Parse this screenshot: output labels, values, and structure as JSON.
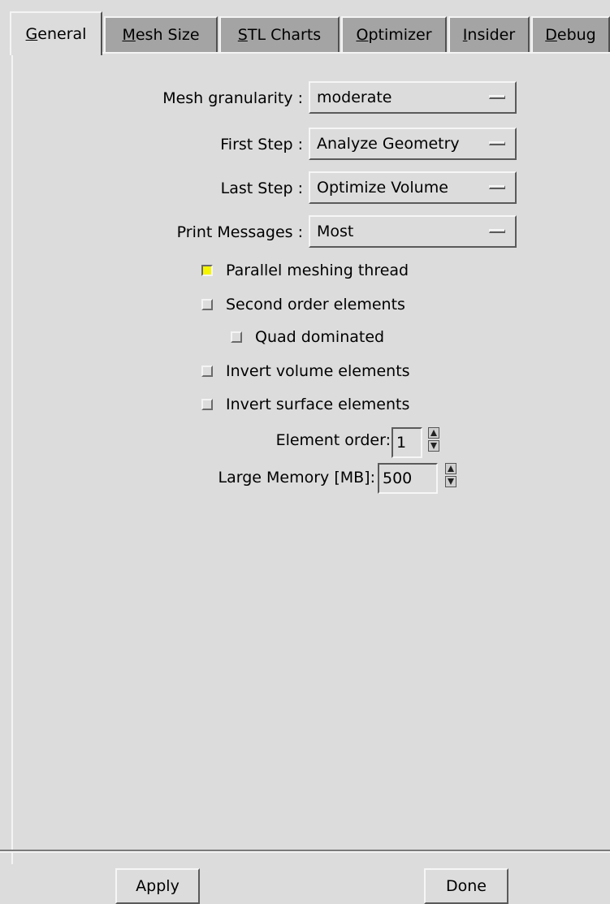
{
  "tabs": [
    {
      "label": "General"
    },
    {
      "label": "Mesh Size"
    },
    {
      "label": "STL Charts"
    },
    {
      "label": "Optimizer"
    },
    {
      "label": "Insider"
    },
    {
      "label": "Debug"
    }
  ],
  "fields": {
    "mesh_granularity": {
      "label": "Mesh granularity :",
      "value": "moderate"
    },
    "first_step": {
      "label": "First Step :",
      "value": "Analyze Geometry"
    },
    "last_step": {
      "label": "Last Step :",
      "value": "Optimize Volume"
    },
    "print_messages": {
      "label": "Print Messages :",
      "value": "Most"
    }
  },
  "checkboxes": {
    "parallel": {
      "label": "Parallel meshing thread",
      "checked": true
    },
    "second_order": {
      "label": "Second order elements",
      "checked": false
    },
    "quad_dominated": {
      "label": "Quad dominated",
      "checked": false
    },
    "invert_volume": {
      "label": "Invert volume elements",
      "checked": false
    },
    "invert_surface": {
      "label": "Invert surface elements",
      "checked": false
    }
  },
  "element_order": {
    "label": "Element order:",
    "value": "1"
  },
  "large_memory": {
    "label": "Large Memory [MB]:",
    "value": "500"
  },
  "buttons": {
    "apply": "Apply",
    "done": "Done"
  },
  "colors": {
    "background": "#dcdcdc",
    "inactive_tab": "#a4a4a4",
    "checked": "#f5f500"
  }
}
